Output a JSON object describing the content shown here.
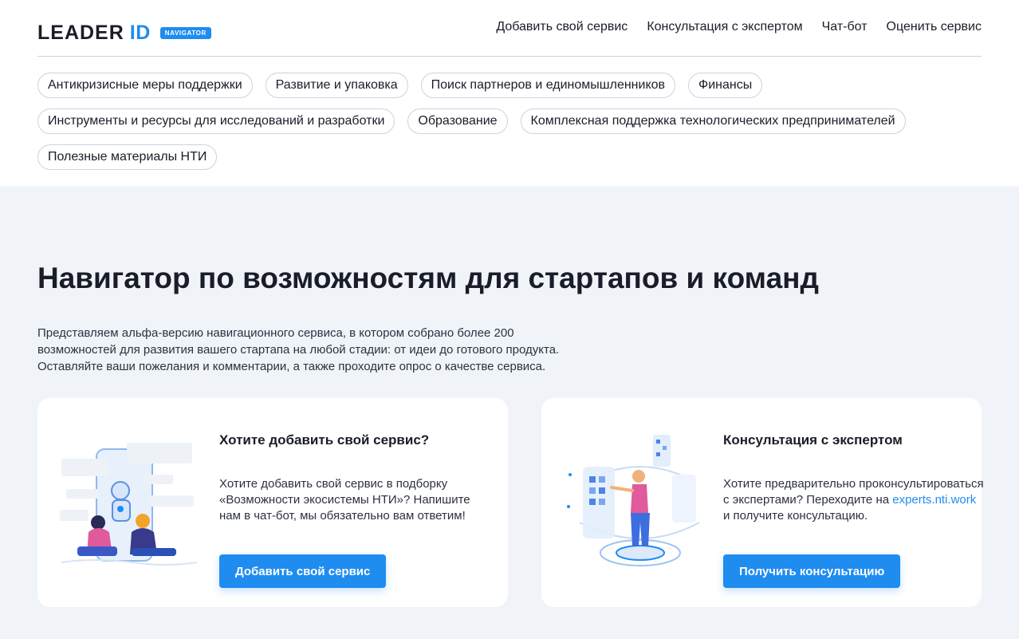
{
  "header": {
    "logo_text": "LEADER",
    "logo_id": "ID",
    "logo_badge": "NAVIGATOR",
    "nav": [
      "Добавить свой сервис",
      "Консультация с экспертом",
      "Чат-бот",
      "Оценить сервис"
    ]
  },
  "chips": {
    "row1": [
      "Антикризисные меры поддержки",
      "Развитие и упаковка",
      "Поиск партнеров и единомышленников",
      "Финансы"
    ],
    "row2": [
      "Инструменты и ресурсы для исследований и разработки",
      "Образование",
      "Комплексная поддержка технологических предпринимателей"
    ],
    "row3": [
      "Полезные материалы НТИ"
    ]
  },
  "hero": {
    "title": "Навигатор по возможностям для стартапов и команд",
    "desc_1": "Представляем альфа-версию навигационного сервиса, в котором собрано более 200",
    "desc_2": "возможностей для развития вашего стартапа на любой стадии: от идеи до готового продукта.",
    "desc_3": "Оставляйте ваши пожелания и комментарии, а также проходите опрос о качестве сервиса."
  },
  "card_add": {
    "title": "Хотите добавить свой сервис?",
    "text": "Хотите добавить свой сервис в подборку «Возможности экосистемы НТИ»? Напишите нам в чат-бот, мы обязательно вам ответим!",
    "button": "Добавить свой сервис"
  },
  "card_expert": {
    "title": "Консультация с экспертом",
    "text_1": "Хотите предварительно проконсультироваться с экспертами? Переходите на ",
    "link": "experts.nti.work",
    "text_2": "и получите консультацию.",
    "button": "Получить консультацию"
  },
  "colors": {
    "accent": "#1f8cf0",
    "page_bg": "#f0f4f8",
    "text": "#1a1d29"
  }
}
